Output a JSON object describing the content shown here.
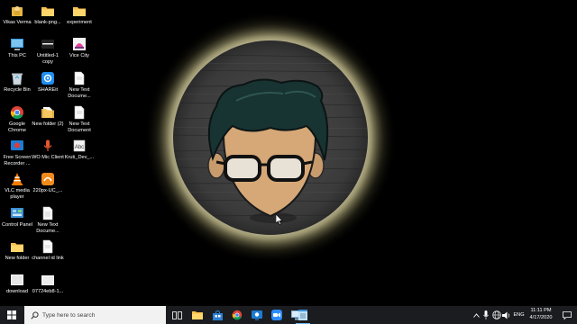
{
  "desktop": {
    "icons": [
      {
        "label": "Vikas Verma",
        "icon": "user-folder-icon"
      },
      {
        "label": "blank-png...",
        "icon": "folder-icon"
      },
      {
        "label": "experiment",
        "icon": "folder-icon"
      },
      {
        "label": "This PC",
        "icon": "this-pc-icon"
      },
      {
        "label": "Untitled-1 copy",
        "icon": "image-file-icon"
      },
      {
        "label": "Vice City",
        "icon": "game-shortcut-icon"
      },
      {
        "label": "Recycle Bin",
        "icon": "recycle-bin-icon"
      },
      {
        "label": "SHAREit",
        "icon": "shareit-icon"
      },
      {
        "label": "New Text Docume...",
        "icon": "text-document-icon"
      },
      {
        "label": "Google Chrome",
        "icon": "chrome-icon"
      },
      {
        "label": "New folder (2)",
        "icon": "folder-icon"
      },
      {
        "label": "New Text Document",
        "icon": "text-document-icon"
      },
      {
        "label": "Free Screen Recorder ...",
        "icon": "screen-recorder-icon"
      },
      {
        "label": "WO Mic Client",
        "icon": "microphone-app-icon"
      },
      {
        "label": "Kruti_Dev_...",
        "icon": "font-file-icon"
      },
      {
        "label": "VLC media player",
        "icon": "vlc-icon"
      },
      {
        "label": "220px-UC_...",
        "icon": "image-file-icon"
      },
      {
        "label": "Control Panel",
        "icon": "control-panel-icon"
      },
      {
        "label": "New Text Docume...",
        "icon": "text-document-icon"
      },
      {
        "label": "New folder",
        "icon": "folder-icon"
      },
      {
        "label": "channel id link",
        "icon": "text-document-icon"
      },
      {
        "label": "download",
        "icon": "image-file-icon"
      },
      {
        "label": "07724eb8-1...",
        "icon": "image-file-icon"
      }
    ],
    "wallpaper": "cartoon-avatar-wallpaper"
  },
  "taskbar": {
    "search_placeholder": "Type here to search",
    "pinned": [
      {
        "icon": "task-view-icon"
      },
      {
        "icon": "file-explorer-icon"
      },
      {
        "icon": "microsoft-store-icon"
      },
      {
        "icon": "chrome-icon"
      },
      {
        "icon": "screen-recorder-icon"
      },
      {
        "icon": "zoom-icon"
      },
      {
        "icon": "network-settings-icon"
      },
      {
        "icon": "notepad-icon"
      }
    ],
    "tray": {
      "language": "ENG",
      "time": "11:11 PM",
      "date": "4/17/2020"
    }
  },
  "colors": {
    "taskbar": "#1a1c20",
    "search_box": "#f2f2f2",
    "accent": "#76b9ed",
    "glow": "#f4eec0"
  }
}
